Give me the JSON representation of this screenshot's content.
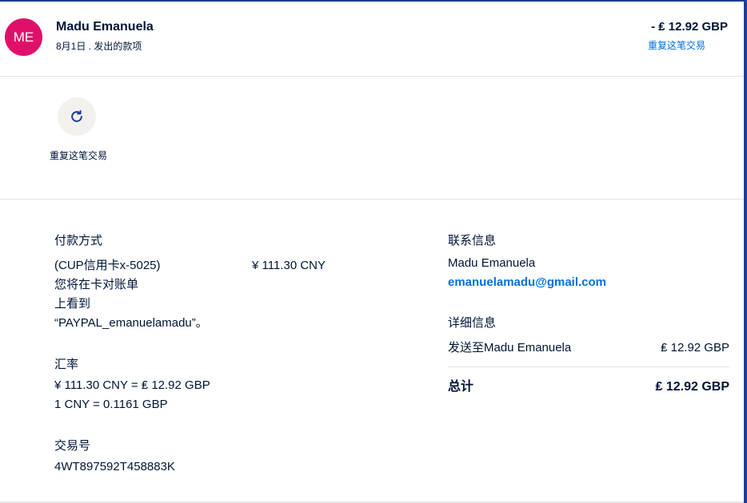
{
  "header": {
    "avatar_initials": "ME",
    "name": "Madu Emanuela",
    "subtitle": "8月1日 . 发出的款项",
    "amount": "- ₤ 12.92 GBP",
    "repeat_link": "重复这笔交易"
  },
  "actions": {
    "repeat_label": "重复这笔交易",
    "icon": "refresh-icon"
  },
  "payment": {
    "heading": "付款方式",
    "card": "(CUP信用卡x-5025)",
    "amount": "¥ 111.30 CNY",
    "note_line1": "您将在卡对账单",
    "note_line2": "上看到",
    "note_line3": "“PAYPAL_emanuelamadu”。"
  },
  "exchange": {
    "heading": "汇率",
    "line1": "¥ 111.30 CNY = ₤ 12.92 GBP",
    "line2": "1 CNY = 0.1161 GBP"
  },
  "transaction": {
    "heading": "交易号",
    "id": "4WT897592T458883K"
  },
  "contact": {
    "heading": "联系信息",
    "name": "Madu Emanuela",
    "email": "emanuelamadu@gmail.com"
  },
  "details": {
    "heading": "详细信息",
    "sent_to_label": "发送至Madu Emanuela",
    "sent_to_amount": "₤ 12.92 GBP",
    "total_label": "总计",
    "total_amount": "₤ 12.92 GBP"
  },
  "colors": {
    "avatar_bg": "#e0106a",
    "link": "#0070e0",
    "border_accent": "#1c3f94",
    "text": "#001435"
  }
}
